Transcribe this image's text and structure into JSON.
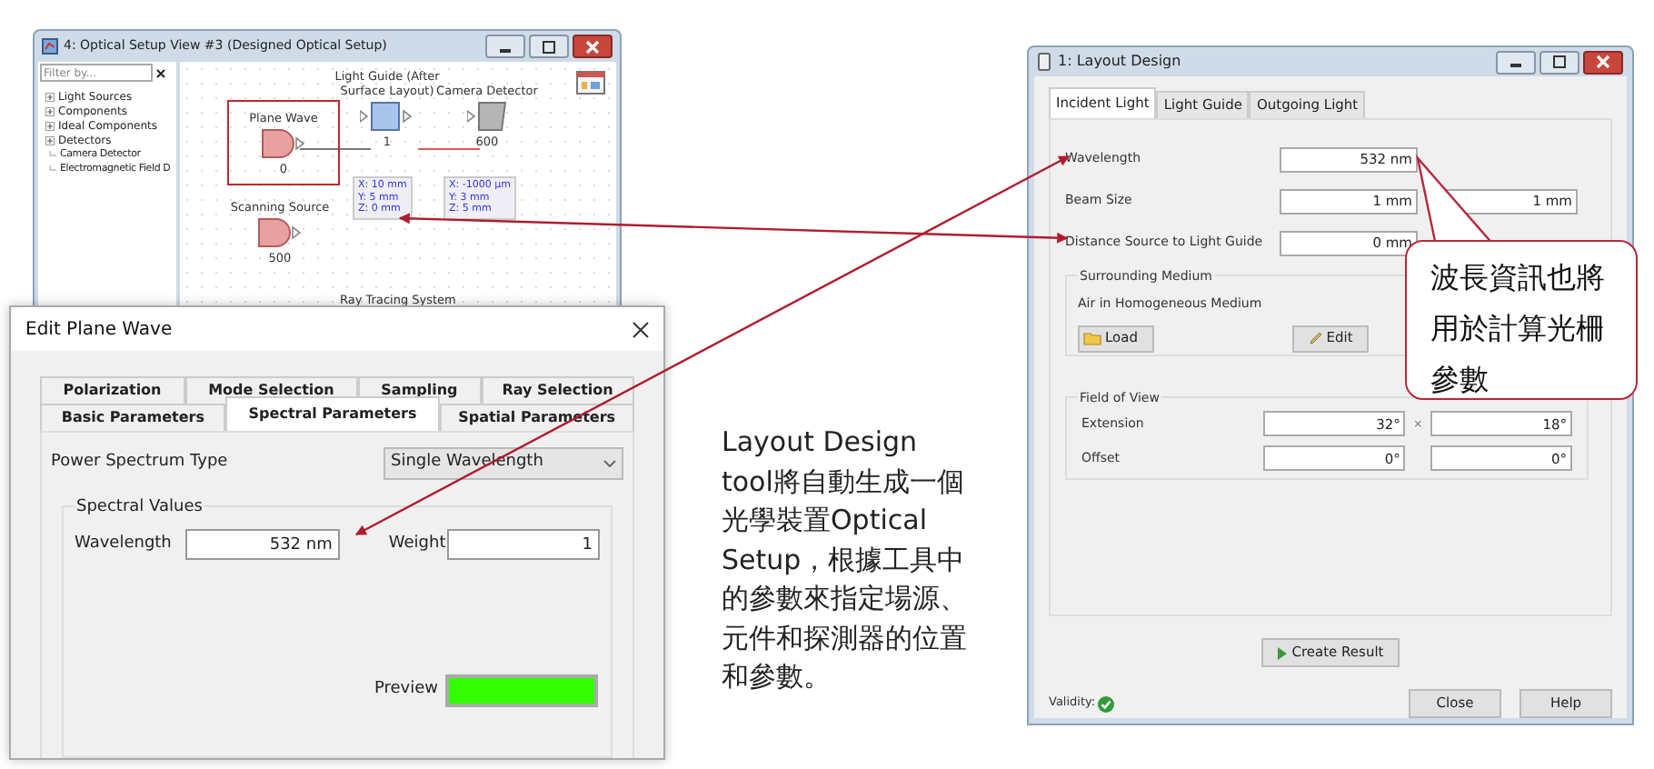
{
  "setup_view": {
    "title": "4: Optical Setup View #3 (Designed Optical Setup)",
    "filter_placeholder": "Filter by...",
    "tree": [
      {
        "label": "Light Sources"
      },
      {
        "label": "Components"
      },
      {
        "label": "Ideal Components"
      },
      {
        "label": "Detectors",
        "children": [
          {
            "label": "Camera Detector"
          },
          {
            "label": "Electromagnetic Field D"
          }
        ]
      }
    ],
    "nodes": [
      {
        "kind": "source",
        "label": "Plane Wave",
        "number": "0",
        "selected": true
      },
      {
        "kind": "component",
        "label": "Light Guide (After Surface Layout)",
        "number": "1",
        "info": [
          "X: 10 mm",
          "Y: 5 mm",
          "Z: 0 mm"
        ],
        "selected": false
      },
      {
        "kind": "detector",
        "label": "Camera Detector",
        "number": "600",
        "info": [
          "X: -1000 µm",
          "Y: 3 mm",
          "Z: 5 mm"
        ],
        "selected": false
      },
      {
        "kind": "source",
        "label": "Scanning Source",
        "number": "500",
        "selected": false
      }
    ],
    "partial_label": "Ray Tracing System"
  },
  "edit_dialog": {
    "title": "Edit Plane Wave",
    "tab_rows": [
      [
        {
          "label": "Polarization",
          "selected": false
        },
        {
          "label": "Mode Selection",
          "selected": false
        },
        {
          "label": "Sampling",
          "selected": false
        },
        {
          "label": "Ray Selection",
          "selected": false
        }
      ],
      [
        {
          "label": "Basic Parameters",
          "selected": false
        },
        {
          "label": "Spectral Parameters",
          "selected": true
        },
        {
          "label": "Spatial Parameters",
          "selected": false
        }
      ]
    ],
    "spectrum_type": {
      "label": "Power Spectrum Type",
      "value": "Single Wavelength"
    },
    "group": {
      "title": "Spectral Values",
      "wavelength": {
        "label": "Wavelength",
        "value": "532 nm"
      },
      "weight": {
        "label": "Weight",
        "value": "1"
      },
      "preview": {
        "label": "Preview",
        "color": "#33ff00"
      }
    }
  },
  "layout_dialog": {
    "title": "1: Layout Design",
    "tabs": [
      {
        "label": "Incident Light",
        "selected": true
      },
      {
        "label": "Light Guide",
        "selected": false
      },
      {
        "label": "Outgoing Light",
        "selected": false
      }
    ],
    "rows": [
      {
        "label": "Wavelength",
        "values": [
          "532 nm"
        ]
      },
      {
        "label": "Beam Size",
        "values": [
          "1 mm",
          "1 mm"
        ]
      },
      {
        "label": "Distance Source to Light Guide",
        "values": [
          "0 mm"
        ]
      }
    ],
    "medium": {
      "title": "Surrounding Medium",
      "text": "Air in Homogeneous Medium",
      "load": "Load",
      "edit": "Edit"
    },
    "fov": {
      "title": "Field of View",
      "rows": [
        {
          "label": "Extension",
          "values": [
            "32°",
            "18°"
          ],
          "separator": "×"
        },
        {
          "label": "Offset",
          "values": [
            "0°",
            "0°"
          ]
        }
      ]
    },
    "create": "Create Result",
    "validity": {
      "label": "Validity:",
      "valid": true
    },
    "buttons": [
      "Close",
      "Help"
    ]
  },
  "callout": "波長資訊也將用於計算光柵參數",
  "annotation": "Layout Design tool將自動生成一個光學裝置Optical Setup，根據工具中的參數來指定場源、元件和探測器的位置和參數。"
}
